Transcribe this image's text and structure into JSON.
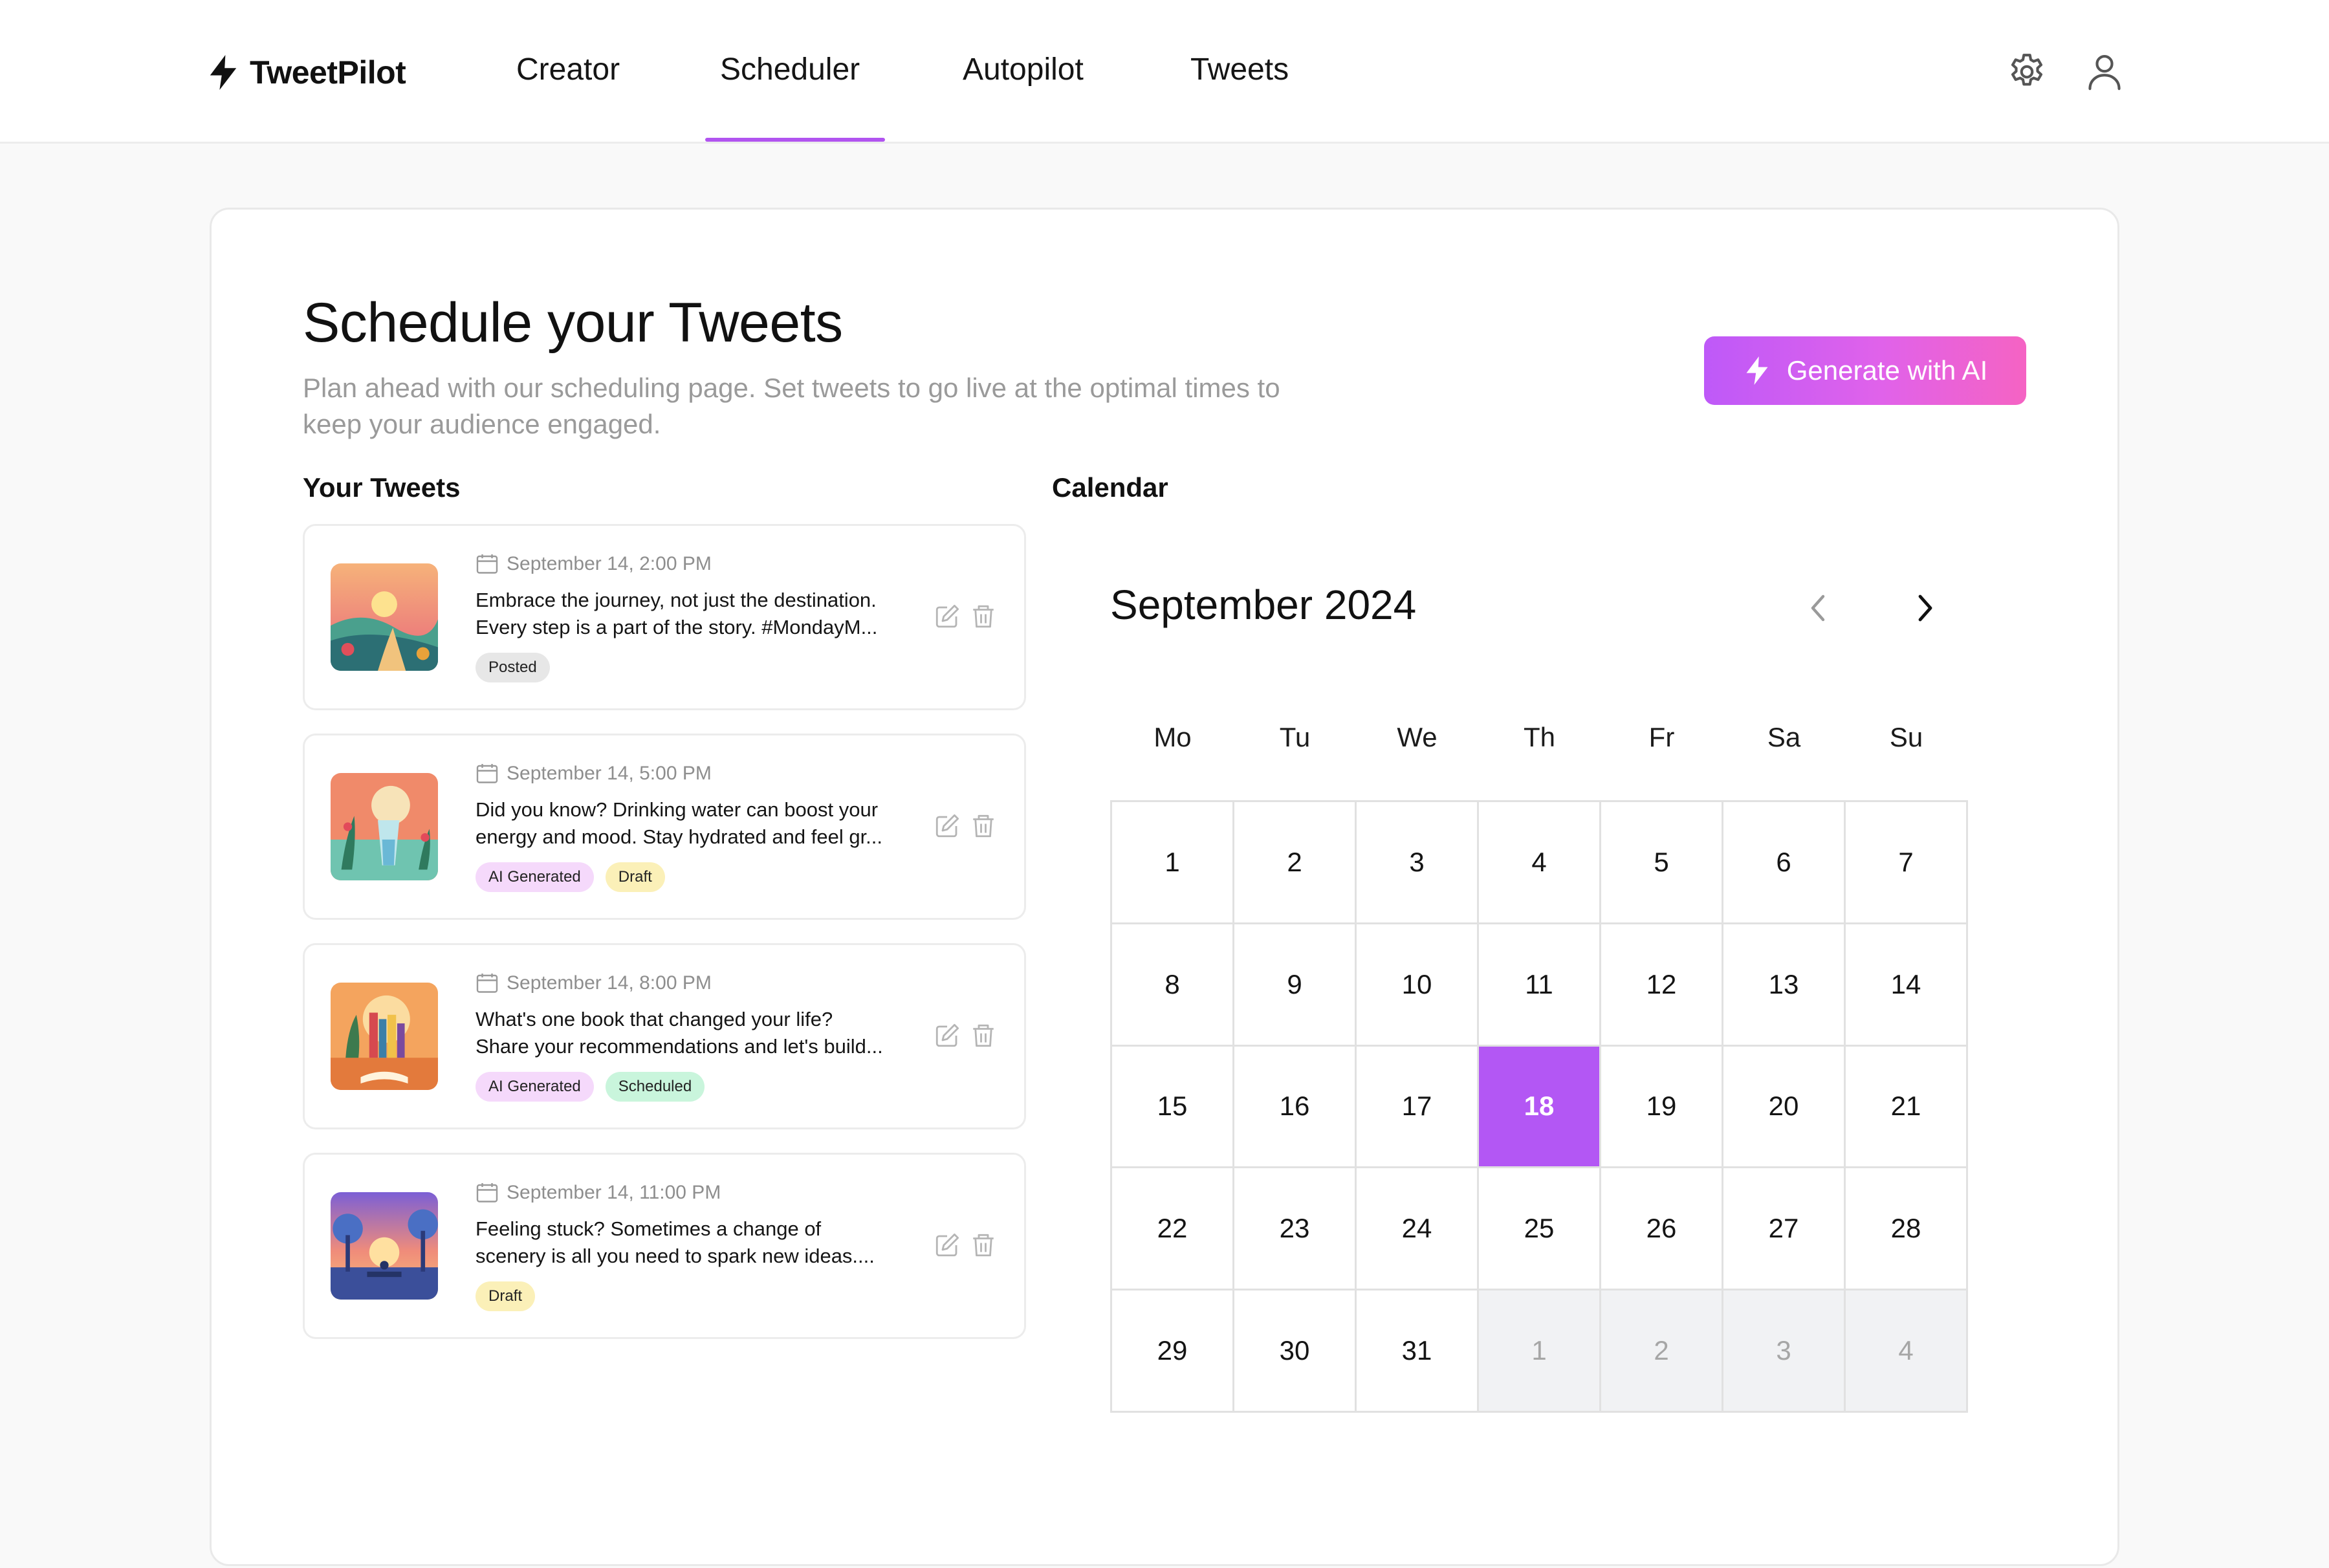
{
  "app": {
    "name": "TweetPilot"
  },
  "nav": {
    "items": [
      "Creator",
      "Scheduler",
      "Autopilot",
      "Tweets"
    ],
    "active": "Scheduler"
  },
  "colors": {
    "accent": "#b357f4",
    "gradient_start": "#be59f8",
    "gradient_end": "#f563c3",
    "tag_posted": "#e7e7e7",
    "tag_ai": "#f5d9fb",
    "tag_draft": "#fbf0b8",
    "tag_scheduled": "#c9f5dc"
  },
  "icons": {
    "logo": "lightning-bolt-icon",
    "settings": "gear-icon",
    "profile": "user-icon",
    "date": "calendar-icon",
    "edit": "pencil-edit-icon",
    "delete": "trash-icon",
    "prev": "chevron-left-icon",
    "next": "chevron-right-icon"
  },
  "page": {
    "title": "Schedule your Tweets",
    "subtitle_line1": "Plan ahead with our scheduling page. Set tweets to go live at the optimal times to",
    "subtitle_line2": "keep your audience engaged.",
    "generate_button": "Generate with AI"
  },
  "sections": {
    "tweets": "Your Tweets",
    "calendar": "Calendar"
  },
  "tweets": [
    {
      "date": "September 14, 2:00 PM",
      "line1": "Embrace the journey, not just the destination.",
      "line2": "Every step is a part of the story. #MondayM...",
      "tags": [
        "Posted"
      ]
    },
    {
      "date": "September 14, 5:00 PM",
      "line1": "Did you know? Drinking water can boost your",
      "line2": "energy and mood. Stay hydrated and feel gr...",
      "tags": [
        "AI Generated",
        "Draft"
      ]
    },
    {
      "date": "September 14, 8:00 PM",
      "line1": "What's one book that changed your life?",
      "line2": "Share your recommendations and let's build...",
      "tags": [
        "AI Generated",
        "Scheduled"
      ]
    },
    {
      "date": "September 14, 11:00 PM",
      "line1": "Feeling stuck? Sometimes a change of",
      "line2": "scenery is all you need to spark new ideas....",
      "tags": [
        "Draft"
      ]
    }
  ],
  "calendar": {
    "month_label": "September 2024",
    "weekdays": [
      "Mo",
      "Tu",
      "We",
      "Th",
      "Fr",
      "Sa",
      "Su"
    ],
    "days": [
      "1",
      "2",
      "3",
      "4",
      "5",
      "6",
      "7",
      "8",
      "9",
      "10",
      "11",
      "12",
      "13",
      "14",
      "15",
      "16",
      "17",
      "18",
      "19",
      "20",
      "21",
      "22",
      "23",
      "24",
      "25",
      "26",
      "27",
      "28",
      "29",
      "30",
      "31"
    ],
    "trailing_days": [
      "1",
      "2",
      "3",
      "4"
    ],
    "selected_day": "18"
  }
}
